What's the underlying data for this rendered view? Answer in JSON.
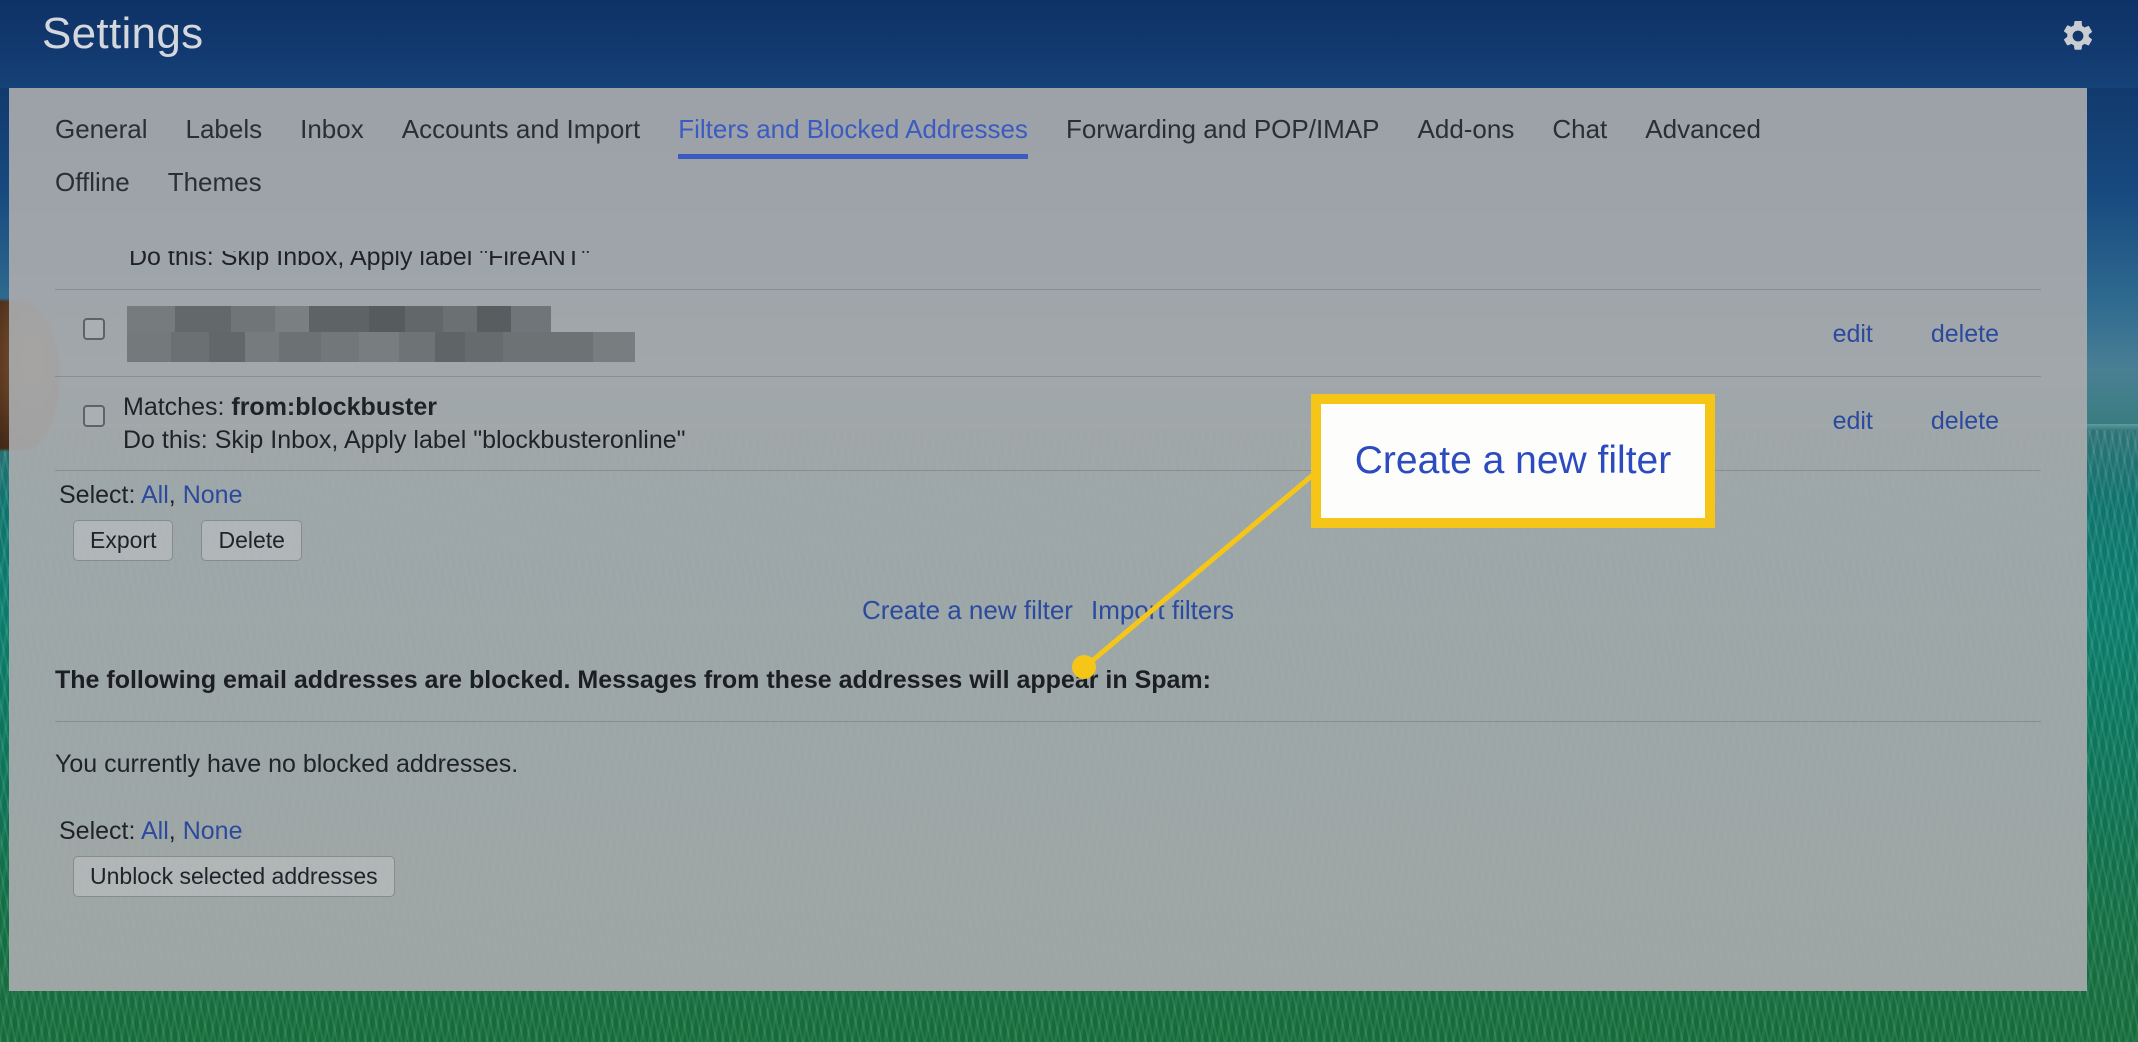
{
  "window": {
    "title": "Settings",
    "gear_icon": "gear-icon"
  },
  "tabs": {
    "row1": [
      {
        "label": "General",
        "active": false
      },
      {
        "label": "Labels",
        "active": false
      },
      {
        "label": "Inbox",
        "active": false
      },
      {
        "label": "Accounts and Import",
        "active": false
      },
      {
        "label": "Filters and Blocked Addresses",
        "active": true
      },
      {
        "label": "Forwarding and POP/IMAP",
        "active": false
      },
      {
        "label": "Add-ons",
        "active": false
      },
      {
        "label": "Chat",
        "active": false
      },
      {
        "label": "Advanced",
        "active": false
      }
    ],
    "row2": [
      {
        "label": "Offline",
        "active": false
      },
      {
        "label": "Themes",
        "active": false
      }
    ]
  },
  "filters": {
    "clipped_row_text": "Do this: Skip Inbox, Apply label \"FireANT\"",
    "rows": [
      {
        "redacted": true,
        "matches_prefix": "",
        "matches_value": "",
        "action_text": "",
        "edit_label": "edit",
        "delete_label": "delete"
      },
      {
        "redacted": false,
        "matches_prefix": "Matches: ",
        "matches_value": "from:blockbuster",
        "action_text": "Do this: Skip Inbox, Apply label \"blockbusteronline\"",
        "edit_label": "edit",
        "delete_label": "delete"
      }
    ],
    "select_prefix": "Select: ",
    "select_all": "All",
    "select_sep": ", ",
    "select_none": "None",
    "export_button": "Export",
    "delete_button": "Delete",
    "create_filter_link": "Create a new filter",
    "import_filters_link": "Import filters"
  },
  "blocked": {
    "heading": "The following email addresses are blocked. Messages from these addresses will appear in Spam:",
    "empty_text": "You currently have no blocked addresses.",
    "select_prefix": "Select: ",
    "select_all": "All",
    "select_sep": ", ",
    "select_none": "None",
    "unblock_button": "Unblock selected addresses"
  },
  "annotation": {
    "callout_text": "Create a new filter",
    "callout_border_color": "#f5c518",
    "dot_color": "#f5c518",
    "line_color": "#f5c518"
  },
  "colors": {
    "link_blue": "#2b4a9e",
    "active_tab_blue": "#3b5bc0",
    "panel_grey": "#a8aaac",
    "header_blue": "#12396f"
  }
}
